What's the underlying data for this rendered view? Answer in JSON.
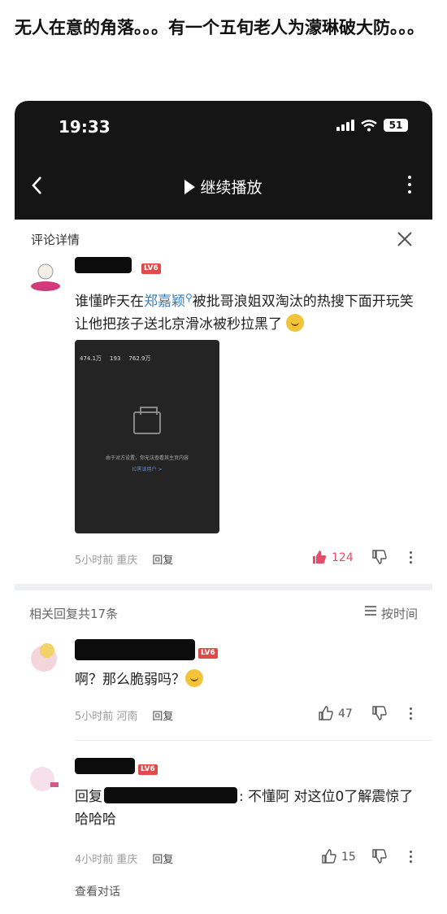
{
  "post": {
    "title": "无人在意的角落。。。有一个五旬老人为濛琳破大防。。。"
  },
  "status_bar": {
    "time": "19:33",
    "battery": "51"
  },
  "nav": {
    "title": "继续播放"
  },
  "comment_detail": {
    "header": "评论详情",
    "level": "LV6",
    "text_before": "谁懂昨天在",
    "link": "郑嘉颖",
    "text_after": "被批哥浪姐双淘汰的热搜下面开玩笑让他把孩子送北京滑冰被秒拉黑了",
    "screenshot": {
      "followers": "474.1万",
      "following": "193",
      "likes": "762.9万",
      "message": "由于对方设置，你无法查看其主页内容",
      "link": "拉黑该用户 >"
    },
    "meta": "5小时前 重庆",
    "reply_label": "回复",
    "likes": "124",
    "accent_color": "#e84a6a"
  },
  "replies": {
    "header": "相关回复共17条",
    "sort_label": "按时间",
    "items": [
      {
        "level": "LV6",
        "text": "啊？那么脆弱吗？",
        "meta": "5小时前 河南",
        "reply_label": "回复",
        "likes": "47"
      },
      {
        "level": "LV6",
        "reply_prefix": "回复",
        "text": ": 不懂阿 对这位0了解震惊了哈哈哈",
        "meta": "4小时前 重庆",
        "reply_label": "回复",
        "likes": "15",
        "view_conversation": "查看对话"
      }
    ]
  }
}
